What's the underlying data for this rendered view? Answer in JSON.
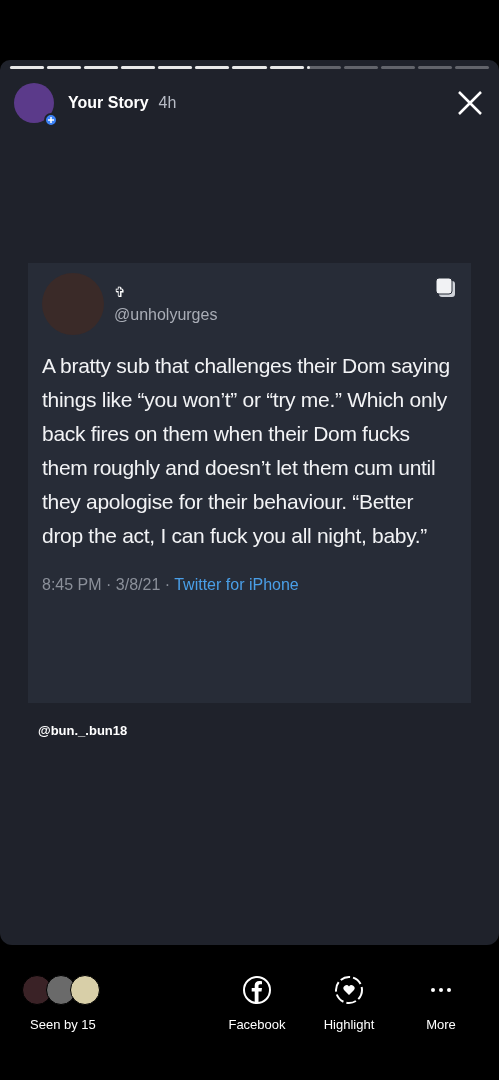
{
  "story_progress": [
    {
      "level": 1
    },
    {
      "level": 1
    },
    {
      "level": 1
    },
    {
      "level": 1
    },
    {
      "level": 1
    },
    {
      "level": 1
    },
    {
      "level": 1
    },
    {
      "level": 1
    },
    {
      "level": 0.1
    },
    {
      "level": 0
    },
    {
      "level": 0
    },
    {
      "level": 0
    },
    {
      "level": 0
    }
  ],
  "header": {
    "title": "Your Story",
    "time": "4h"
  },
  "tweet": {
    "display_name": "✞",
    "handle": "@unholyurges",
    "text": "A bratty sub that challenges their Dom saying things like “you won’t” or “try me.” Which only back fires on them when their Dom fucks them roughly and doesn’t let them cum until they apologise for their behaviour. “Better drop the act, I can fuck you all night, baby.”",
    "timestamp": "8:45 PM · 3/8/21 · ",
    "source": "Twitter for iPhone"
  },
  "mention": "@bun._.bun18",
  "footer": {
    "seen_by": "Seen by 15",
    "actions": [
      {
        "kind": "facebook",
        "label": "Facebook"
      },
      {
        "kind": "highlight",
        "label": "Highlight"
      },
      {
        "kind": "more",
        "label": "More"
      }
    ]
  }
}
